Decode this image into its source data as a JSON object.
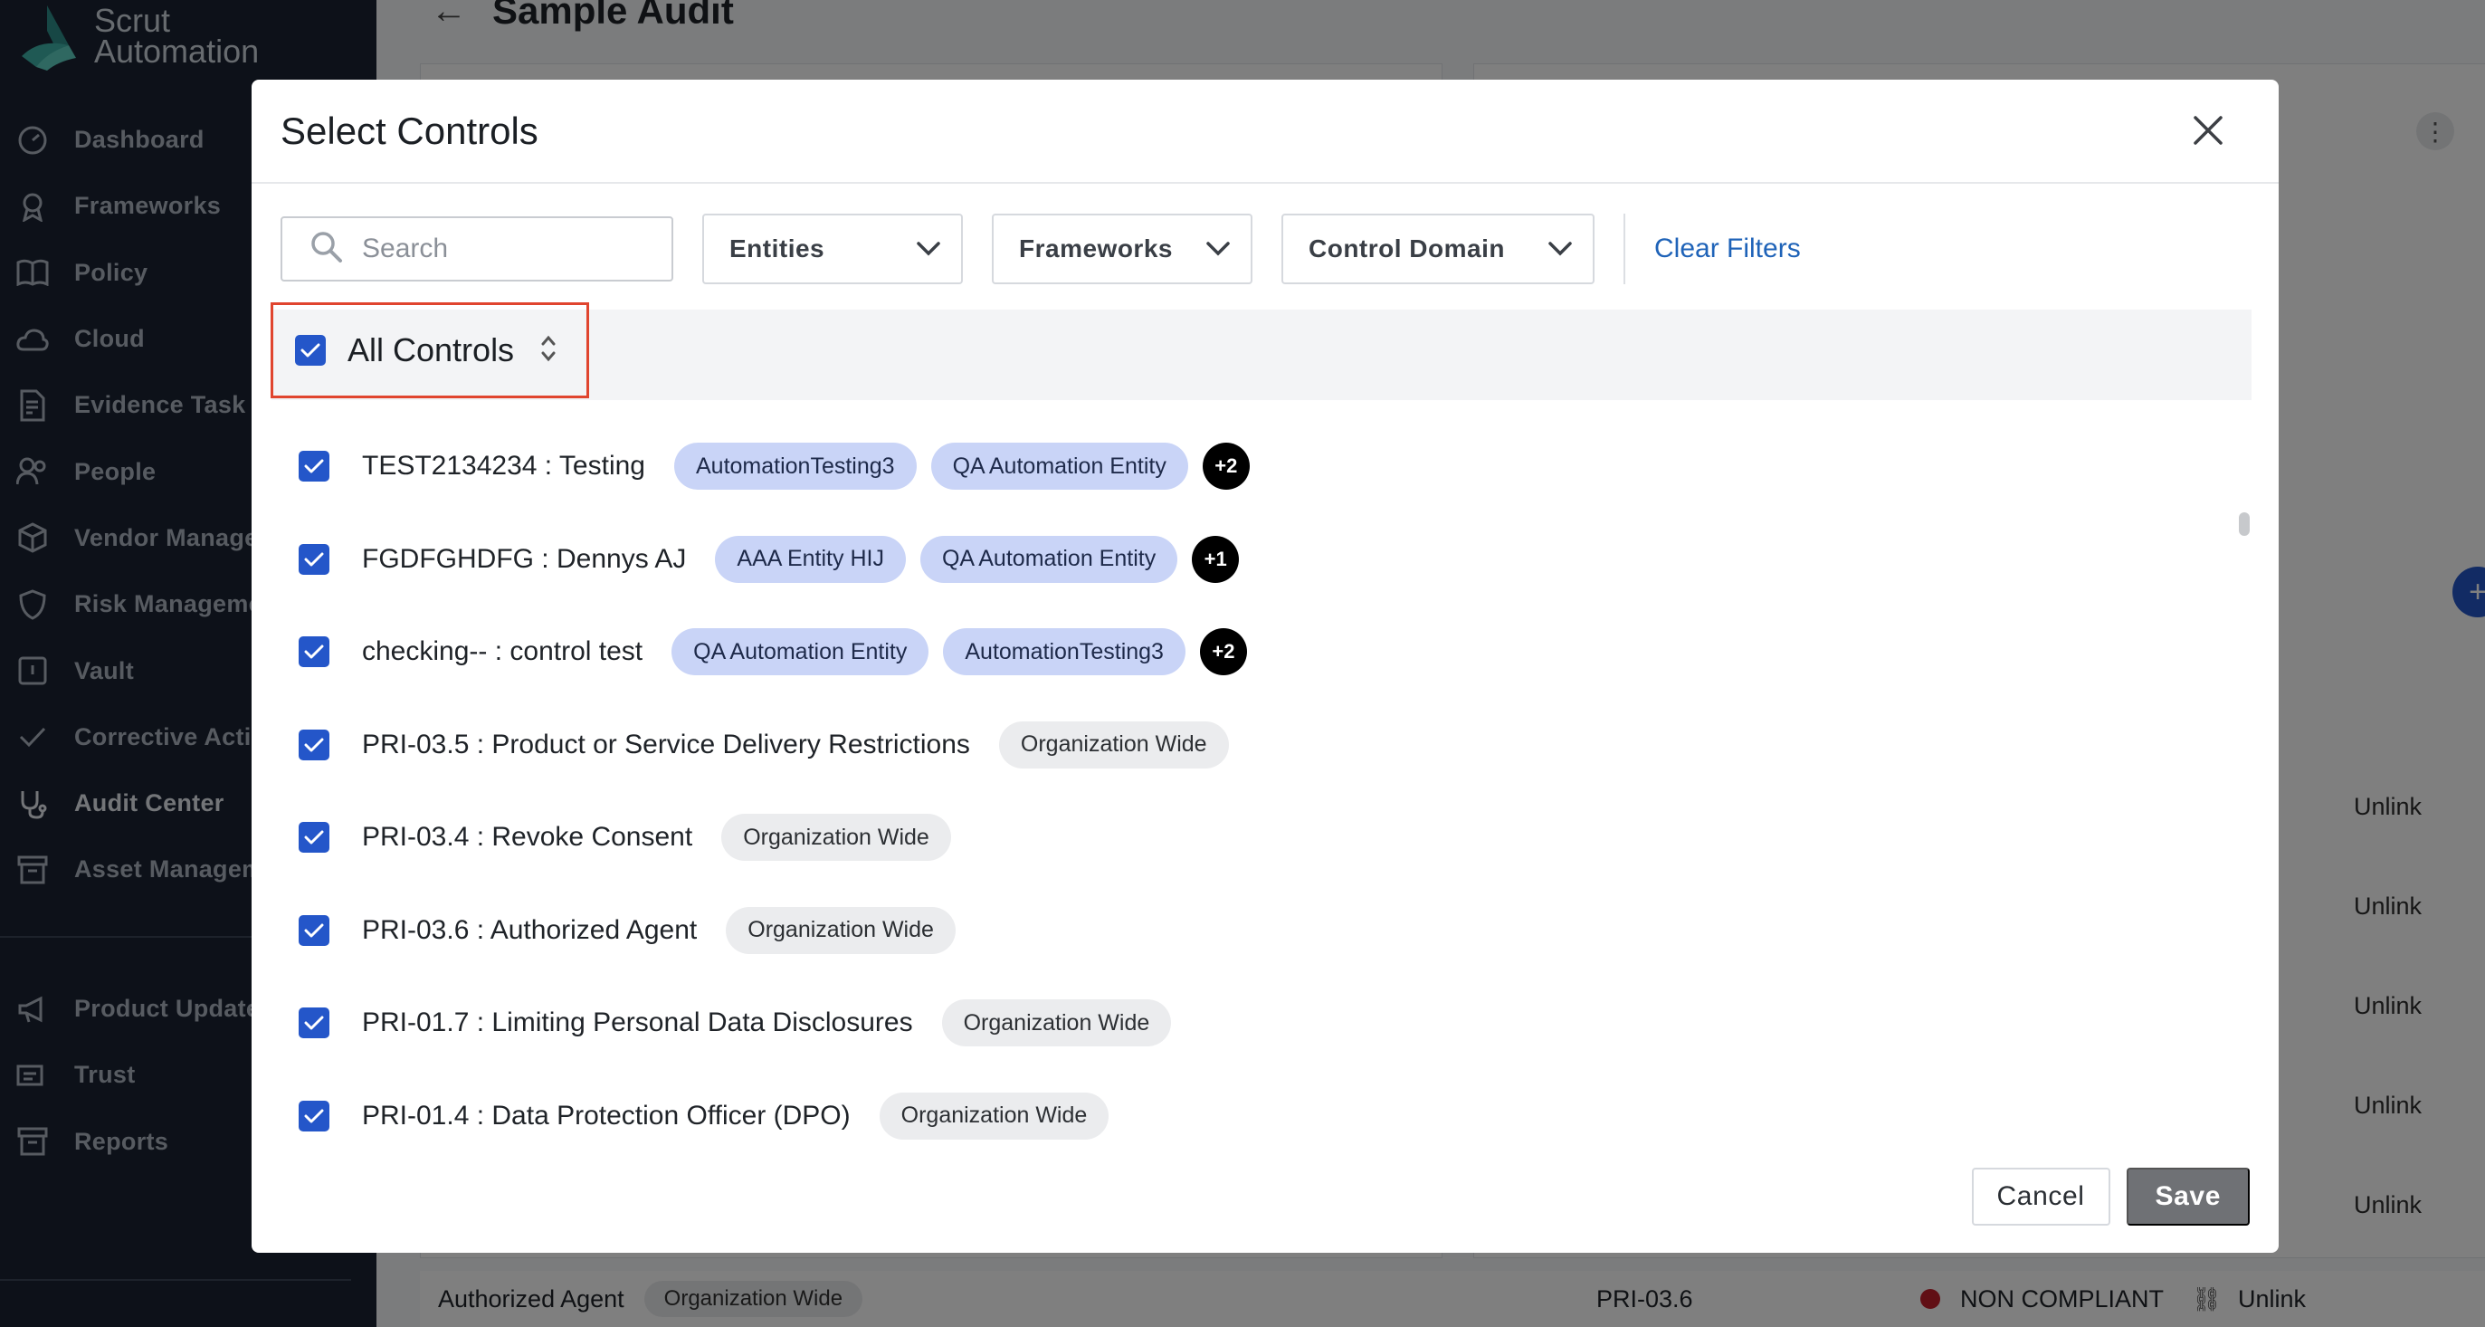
{
  "app": {
    "brand_line1": "Scrut",
    "brand_line2": "Automation"
  },
  "sidebar": {
    "items": [
      {
        "label": "Dashboard",
        "icon": "dashboard-icon"
      },
      {
        "label": "Frameworks",
        "icon": "award-icon"
      },
      {
        "label": "Policy",
        "icon": "book-icon"
      },
      {
        "label": "Cloud",
        "icon": "cloud-icon"
      },
      {
        "label": "Evidence Task",
        "icon": "evidence-icon"
      },
      {
        "label": "People",
        "icon": "people-icon"
      },
      {
        "label": "Vendor Management",
        "icon": "cube-icon"
      },
      {
        "label": "Risk Management",
        "icon": "shield-icon"
      },
      {
        "label": "Vault",
        "icon": "vault-icon"
      },
      {
        "label": "Corrective Actions",
        "icon": "check-icon"
      },
      {
        "label": "Audit Center",
        "icon": "stethoscope-icon"
      },
      {
        "label": "Asset Management",
        "icon": "archive-icon"
      }
    ],
    "bottom_items": [
      {
        "label": "Product Updates",
        "icon": "megaphone-icon"
      },
      {
        "label": "Trust",
        "icon": "trust-icon"
      },
      {
        "label": "Reports",
        "icon": "reports-icon"
      }
    ]
  },
  "page": {
    "title": "Sample Audit",
    "unlink_label": "Unlink",
    "bottom_row": {
      "name": "Authorized Agent",
      "tag": "Organization Wide",
      "code": "PRI-03.6",
      "status": "NON COMPLIANT",
      "action": "Unlink"
    }
  },
  "modal": {
    "title": "Select Controls",
    "search_placeholder": "Search",
    "filters": {
      "entities": "Entities",
      "frameworks": "Frameworks",
      "control_domain": "Control Domain",
      "clear": "Clear Filters"
    },
    "header_label": "All Controls",
    "rows": [
      {
        "label": "TEST2134234 : Testing",
        "tags": [
          "AutomationTesting3",
          "QA Automation Entity"
        ],
        "more": "+2",
        "tag_style": "blue"
      },
      {
        "label": "FGDFGHDFG : Dennys AJ",
        "tags": [
          "AAA Entity HIJ",
          "QA Automation Entity"
        ],
        "more": "+1",
        "tag_style": "blue"
      },
      {
        "label": "checking-- : control test",
        "tags": [
          "QA Automation Entity",
          "AutomationTesting3"
        ],
        "more": "+2",
        "tag_style": "blue"
      },
      {
        "label": "PRI-03.5 : Product or Service Delivery Restrictions",
        "tags": [
          "Organization Wide"
        ],
        "more": null,
        "tag_style": "gray"
      },
      {
        "label": "PRI-03.4 : Revoke Consent",
        "tags": [
          "Organization Wide"
        ],
        "more": null,
        "tag_style": "gray"
      },
      {
        "label": "PRI-03.6 : Authorized Agent",
        "tags": [
          "Organization Wide"
        ],
        "more": null,
        "tag_style": "gray"
      },
      {
        "label": "PRI-01.7 : Limiting Personal Data Disclosures",
        "tags": [
          "Organization Wide"
        ],
        "more": null,
        "tag_style": "gray"
      },
      {
        "label": "PRI-01.4 : Data Protection Officer (DPO)",
        "tags": [
          "Organization Wide"
        ],
        "more": null,
        "tag_style": "gray"
      }
    ],
    "cancel_label": "Cancel",
    "save_label": "Save"
  },
  "colors": {
    "accent": "#2456c9",
    "highlight_border": "#e0452f",
    "link": "#1f63b8",
    "sidebar_bg": "#1a2332",
    "status_red": "#c21f2b"
  }
}
